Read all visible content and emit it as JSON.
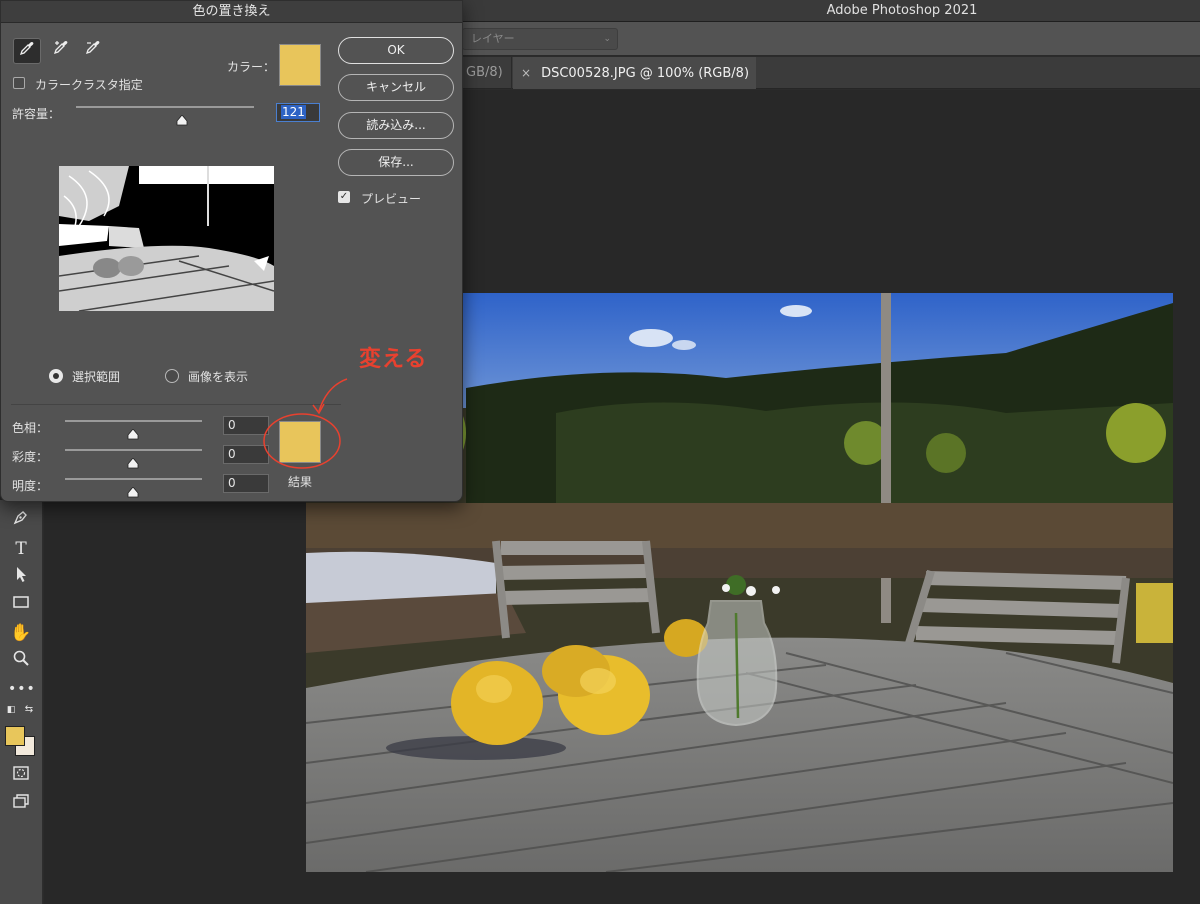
{
  "app": {
    "title": "Adobe Photoshop 2021",
    "layer_select_placeholder": "レイヤー"
  },
  "tabs": [
    {
      "label": "GB/8)"
    },
    {
      "label": "DSC00528.JPG @ 100% (RGB/8) *",
      "close": "×"
    }
  ],
  "dialog": {
    "title": "色の置き換え",
    "color_label": "カラー：",
    "color_value": "#e8c55b",
    "cluster_label": "カラークラスタ指定",
    "cluster_checked": false,
    "tolerance_label": "許容量：",
    "tolerance_value": "121",
    "mode_selection": "選択範囲",
    "mode_image": "画像を表示",
    "selected_mode": "選択範囲",
    "hue_label": "色相：",
    "hue_value": "0",
    "saturation_label": "彩度：",
    "saturation_value": "0",
    "lightness_label": "明度：",
    "lightness_value": "0",
    "result_label": "結果",
    "result_color": "#e8c55b",
    "buttons": {
      "ok": "OK",
      "cancel": "キャンセル",
      "load": "読み込み...",
      "save": "保存..."
    },
    "preview_label": "プレビュー",
    "preview_checked": true
  },
  "annotation": {
    "text": "変える",
    "color": "#e8412f"
  },
  "toolbar": {
    "foreground_color": "#e8c65b",
    "background_color": "#f2e9dc"
  }
}
